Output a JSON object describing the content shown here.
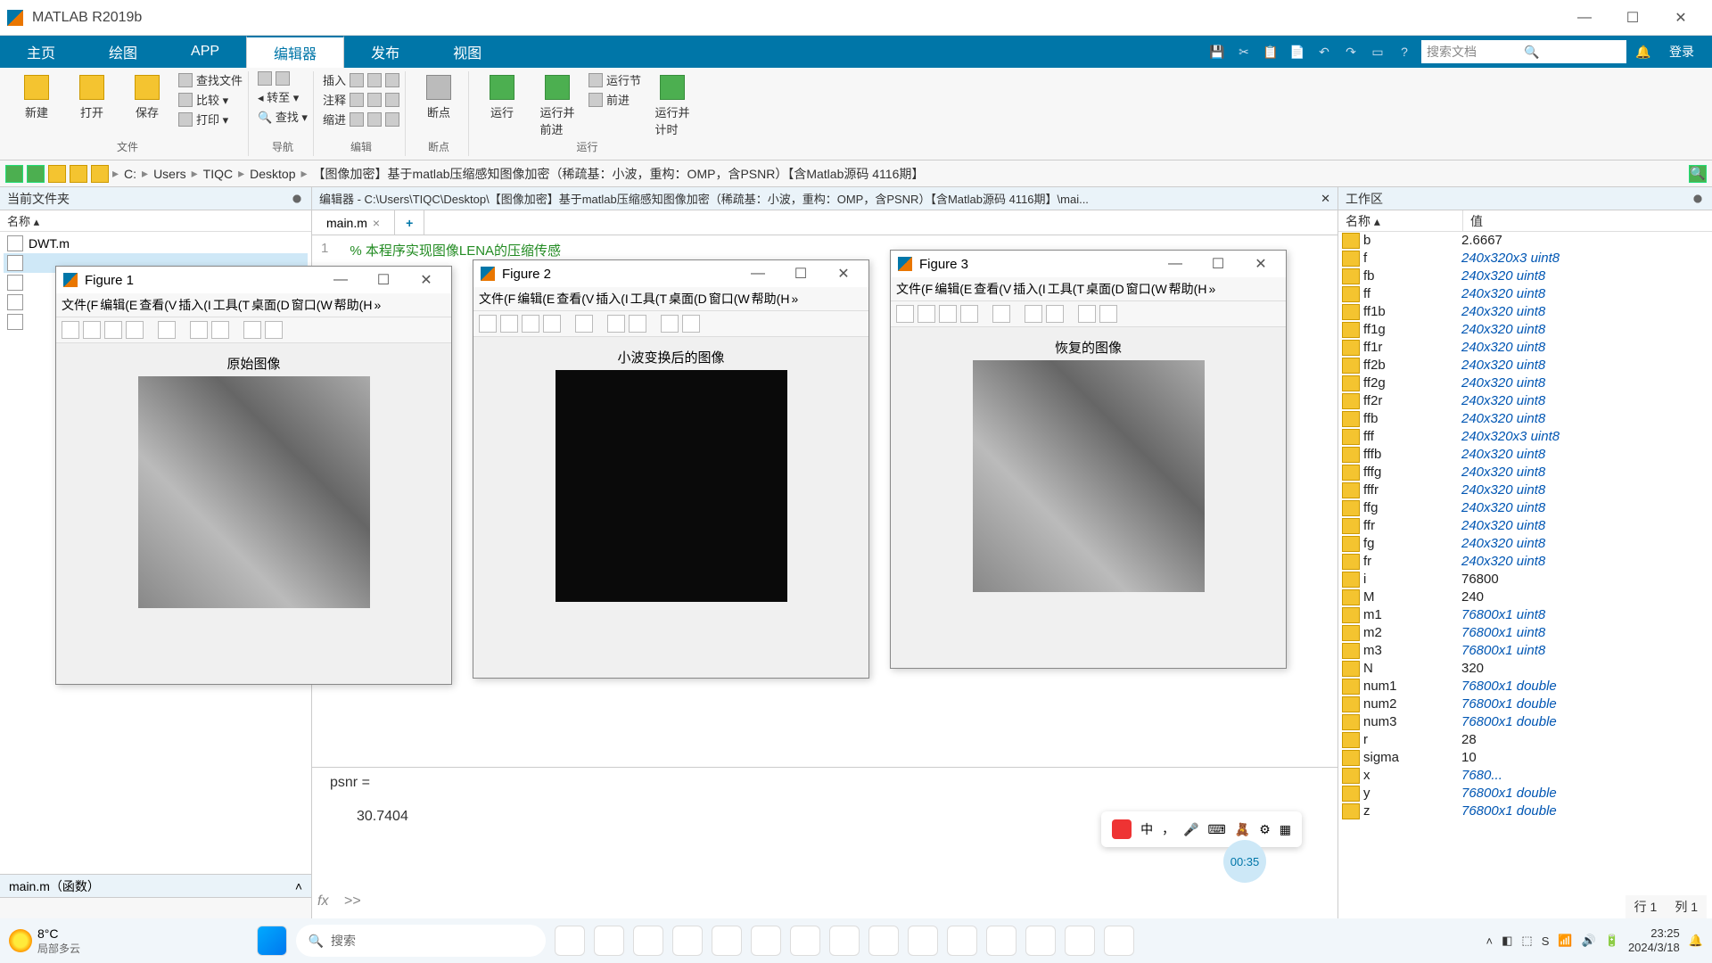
{
  "window": {
    "title": "MATLAB R2019b"
  },
  "tabs": {
    "home": "主页",
    "plots": "绘图",
    "apps": "APP",
    "editor": "编辑器",
    "publish": "发布",
    "view": "视图"
  },
  "search": {
    "placeholder": "搜索文档",
    "login": "登录"
  },
  "ribbon": {
    "new": "新建",
    "open": "打开",
    "save": "保存",
    "findfiles": "查找文件",
    "compare": "比较 ▾",
    "print": "打印 ▾",
    "goto": "◂ 转至 ▾",
    "find": "🔍 查找 ▾",
    "insert": "插入",
    "comment": "注释",
    "indent": "缩进",
    "breakpoints": "断点",
    "run": "运行",
    "runadvance": "运行并\n前进",
    "runsection": "运行节",
    "advance": "前进",
    "runtime": "运行并\n计时",
    "g_file": "文件",
    "g_nav": "导航",
    "g_edit": "编辑",
    "g_bp": "断点",
    "g_run": "运行"
  },
  "addr": {
    "crumbs": [
      "C:",
      "Users",
      "TIQC",
      "Desktop",
      "【图像加密】基于matlab压缩感知图像加密（稀疏基：小波，重构：OMP，含PSNR）【含Matlab源码 4116期】"
    ]
  },
  "leftpane": {
    "title": "当前文件夹",
    "colname": "名称 ▴",
    "dwt": "DWT.m"
  },
  "editor": {
    "header": "编辑器 - C:\\Users\\TIQC\\Desktop\\【图像加密】基于matlab压缩感知图像加密（稀疏基：小波，重构：OMP，含PSNR）【含Matlab源码 4116期】\\mai...",
    "tab": "main.m",
    "line1_no": "1",
    "line1_txt": "%  本程序实现图像LENA的压缩传感"
  },
  "cmd": {
    "psnr_label": "psnr =",
    "psnr_val": "30.7404",
    "fx": "fx",
    "prompt": ">>"
  },
  "statusline": "main.m（函数）",
  "cursor": {
    "line": "行  1",
    "col": "列  1"
  },
  "workspace": {
    "title": "工作区",
    "col_name": "名称 ▴",
    "col_value": "值",
    "vars": [
      {
        "n": "b",
        "v": "2.6667",
        "plain": true
      },
      {
        "n": "f",
        "v": "240x320x3 uint8"
      },
      {
        "n": "fb",
        "v": "240x320 uint8"
      },
      {
        "n": "ff",
        "v": "240x320 uint8"
      },
      {
        "n": "ff1b",
        "v": "240x320 uint8"
      },
      {
        "n": "ff1g",
        "v": "240x320 uint8"
      },
      {
        "n": "ff1r",
        "v": "240x320 uint8"
      },
      {
        "n": "ff2b",
        "v": "240x320 uint8"
      },
      {
        "n": "ff2g",
        "v": "240x320 uint8"
      },
      {
        "n": "ff2r",
        "v": "240x320 uint8"
      },
      {
        "n": "ffb",
        "v": "240x320 uint8"
      },
      {
        "n": "fff",
        "v": "240x320x3 uint8"
      },
      {
        "n": "fffb",
        "v": "240x320 uint8"
      },
      {
        "n": "fffg",
        "v": "240x320 uint8"
      },
      {
        "n": "fffr",
        "v": "240x320 uint8"
      },
      {
        "n": "ffg",
        "v": "240x320 uint8"
      },
      {
        "n": "ffr",
        "v": "240x320 uint8"
      },
      {
        "n": "fg",
        "v": "240x320 uint8"
      },
      {
        "n": "fr",
        "v": "240x320 uint8"
      },
      {
        "n": "i",
        "v": "76800",
        "plain": true
      },
      {
        "n": "M",
        "v": "240",
        "plain": true
      },
      {
        "n": "m1",
        "v": "76800x1 uint8"
      },
      {
        "n": "m2",
        "v": "76800x1 uint8"
      },
      {
        "n": "m3",
        "v": "76800x1 uint8"
      },
      {
        "n": "N",
        "v": "320",
        "plain": true
      },
      {
        "n": "num1",
        "v": "76800x1 double"
      },
      {
        "n": "num2",
        "v": "76800x1 double"
      },
      {
        "n": "num3",
        "v": "76800x1 double"
      },
      {
        "n": "r",
        "v": "28",
        "plain": true
      },
      {
        "n": "sigma",
        "v": "10",
        "plain": true
      },
      {
        "n": "x",
        "v": "7680..."
      },
      {
        "n": "y",
        "v": "76800x1 double"
      },
      {
        "n": "z",
        "v": "76800x1 double"
      }
    ]
  },
  "fig_menu": {
    "file": "文件(F",
    "edit": "编辑(E",
    "view": "查看(V",
    "insert": "插入(I",
    "tools": "工具(T",
    "desktop": "桌面(D",
    "window": "窗口(W",
    "help": "帮助(H",
    "more": "»"
  },
  "fig1": {
    "title": "Figure 1",
    "caption": "原始图像"
  },
  "fig2": {
    "title": "Figure 2",
    "caption": "小波变换后的图像"
  },
  "fig3": {
    "title": "Figure 3",
    "caption": "恢复的图像"
  },
  "taskbar": {
    "temp": "8°C",
    "weather": "局部多云",
    "search": "搜索",
    "time": "23:25",
    "date": "2024/3/18",
    "lang": "中"
  },
  "timer": "00:35"
}
